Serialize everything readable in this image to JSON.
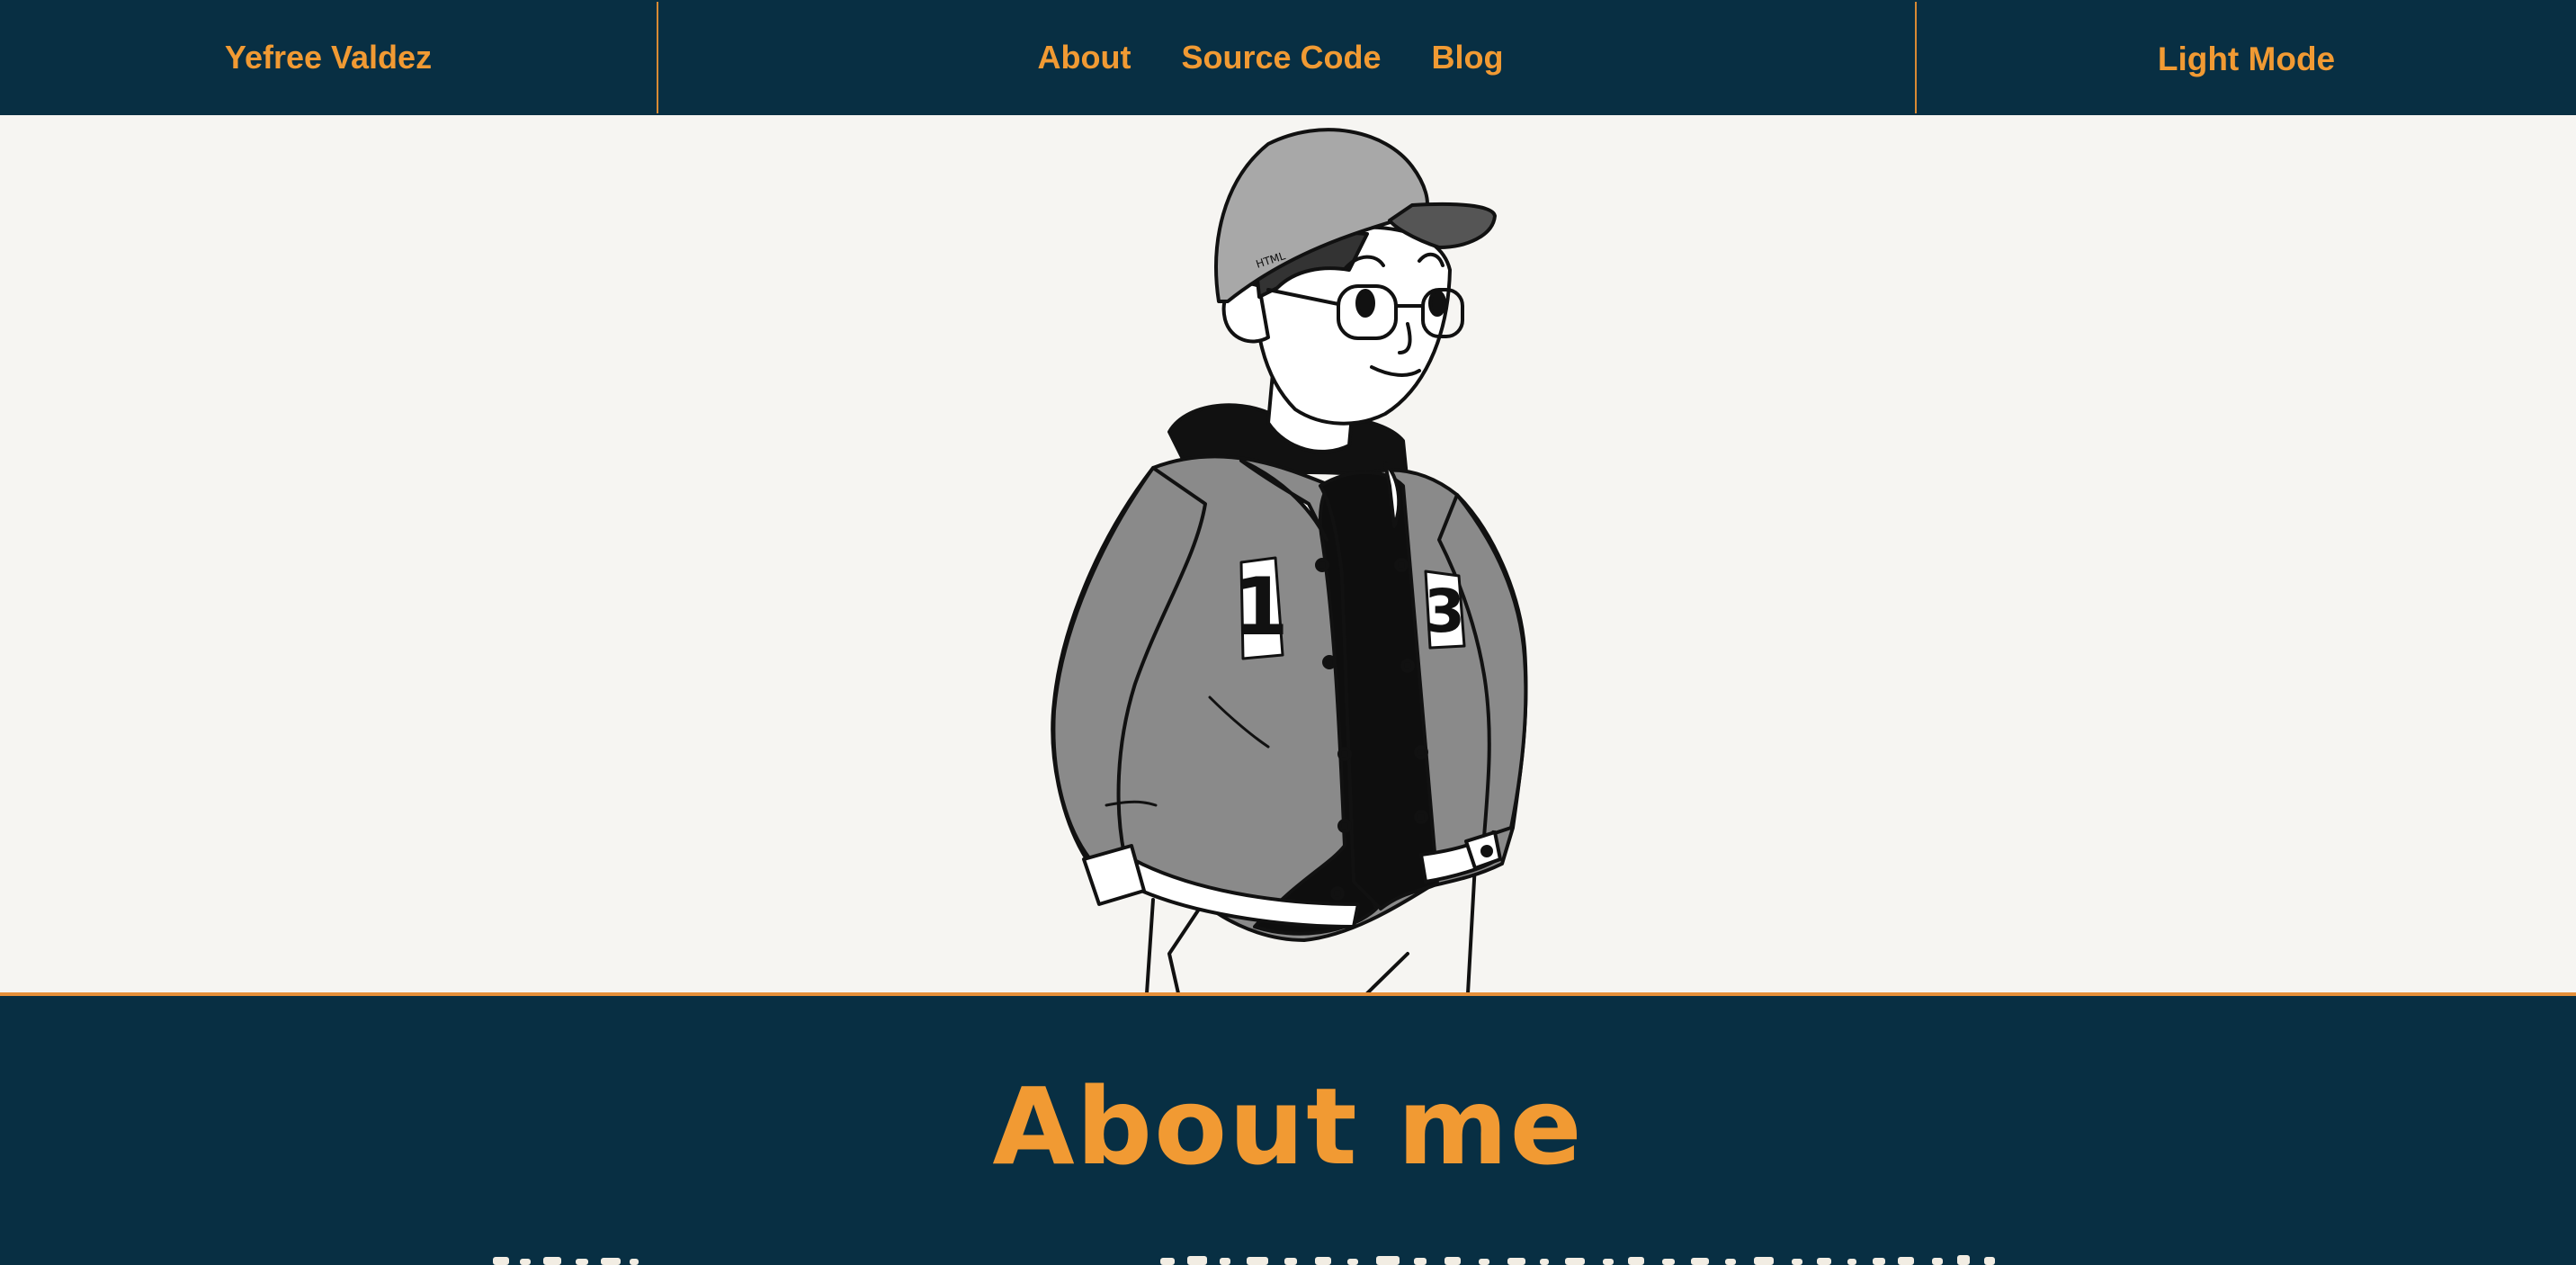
{
  "header": {
    "brand": "Yefree Valdez",
    "nav": [
      {
        "label": "About"
      },
      {
        "label": "Source Code"
      },
      {
        "label": "Blog"
      }
    ],
    "theme_toggle": "Light Mode"
  },
  "hero": {
    "illustration": "cartoon-self-portrait",
    "jacket_numbers": [
      "1",
      "3"
    ],
    "cap_text": "HTML"
  },
  "about": {
    "title": "About me"
  },
  "colors": {
    "navy": "#082f43",
    "accent": "#f19a33",
    "background": "#f6f5f2"
  }
}
